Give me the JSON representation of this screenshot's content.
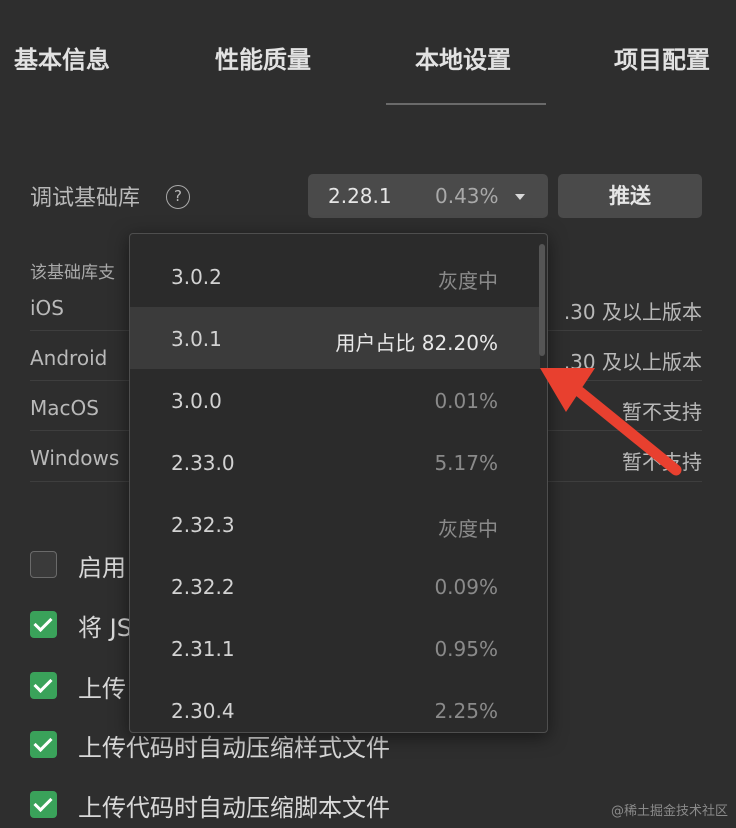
{
  "tabs": [
    "基本信息",
    "性能质量",
    "本地设置",
    "项目配置"
  ],
  "active_tab": "本地设置",
  "debug_lib": {
    "label": "调试基础库",
    "help_icon": "?",
    "current_version": "2.28.1",
    "current_percent": "0.43%",
    "push_button": "推送"
  },
  "support": {
    "title": "该基础库支",
    "platforms": [
      {
        "name": "iOS",
        "value": ".30 及以上版本"
      },
      {
        "name": "Android",
        "value": ".30 及以上版本"
      },
      {
        "name": "MacOS",
        "value": "暂不支持"
      },
      {
        "name": "Windows",
        "value": "暂不支持"
      }
    ]
  },
  "checkboxes": [
    {
      "label": "启用",
      "checked": false
    },
    {
      "label": "将 JS",
      "checked": true
    },
    {
      "label": "上传",
      "checked": true
    },
    {
      "label": "上传代码时自动压缩样式文件",
      "checked": true
    },
    {
      "label": "上传代码时自动压缩脚本文件",
      "checked": true
    }
  ],
  "dropdown": {
    "items": [
      {
        "version": "3.0.2",
        "info": "灰度中"
      },
      {
        "version": "3.0.1",
        "info": "用户占比  82.20%",
        "selected": true
      },
      {
        "version": "3.0.0",
        "info": "0.01%"
      },
      {
        "version": "2.33.0",
        "info": "5.17%"
      },
      {
        "version": "2.32.3",
        "info": "灰度中"
      },
      {
        "version": "2.32.2",
        "info": "0.09%"
      },
      {
        "version": "2.31.1",
        "info": "0.95%"
      },
      {
        "version": "2.30.4",
        "info": "2.25%"
      }
    ]
  },
  "annotation_color": "#e8402f",
  "watermark": "@稀土掘金技术社区"
}
